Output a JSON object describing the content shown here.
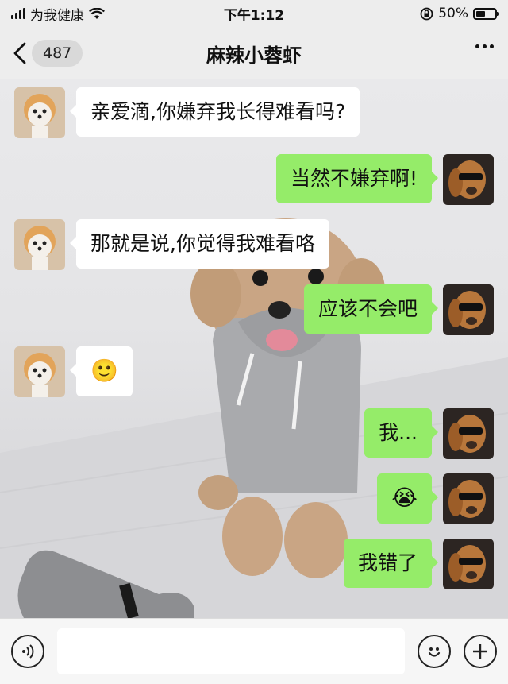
{
  "status_bar": {
    "carrier": "为我健康",
    "time": "下午1:12",
    "battery_text": "50%",
    "battery_level": 0.5,
    "icons": [
      "signal-icon",
      "wifi-icon",
      "rotation-lock-icon",
      "battery-icon"
    ]
  },
  "nav": {
    "unread_count": "487",
    "title": "麻辣小蓉虾",
    "back_icon": "chevron-left-icon",
    "more_icon": "ellipsis-icon"
  },
  "messages": [
    {
      "side": "left",
      "type": "text",
      "text": "亲爱滴,你嫌弃我长得难看吗?"
    },
    {
      "side": "right",
      "type": "text",
      "text": "当然不嫌弃啊!"
    },
    {
      "side": "left",
      "type": "text",
      "text": "那就是说,你觉得我难看咯"
    },
    {
      "side": "right",
      "type": "text",
      "text": "应该不会吧"
    },
    {
      "side": "left",
      "type": "emoji",
      "text": "🙂",
      "icon": "smile-emoji"
    },
    {
      "side": "right",
      "type": "text",
      "text": "我..."
    },
    {
      "side": "right",
      "type": "emoji",
      "text": "😭",
      "icon": "crying-emoji"
    },
    {
      "side": "right",
      "type": "text",
      "text": "我错了"
    }
  ],
  "input_bar": {
    "voice_icon": "voice-icon",
    "emoji_icon": "emoji-face-icon",
    "plus_icon": "plus-icon",
    "input_value": ""
  },
  "colors": {
    "sent_bubble": "#95ec69",
    "received_bubble": "#ffffff",
    "bar_background": "#ededed"
  }
}
